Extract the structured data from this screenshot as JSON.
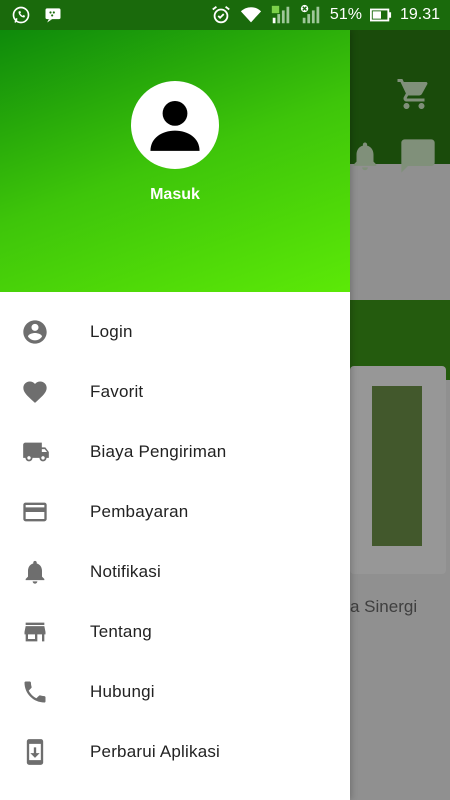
{
  "status_bar": {
    "battery": "51%",
    "time": "19.31",
    "icons": [
      "whatsapp-icon",
      "bbm-icon",
      "alarm-icon",
      "wifi-icon",
      "signal-icon",
      "signal-no-sim-icon",
      "battery-icon"
    ]
  },
  "drawer": {
    "user_label": "Masuk",
    "items": [
      {
        "label": "Login",
        "icon": "account-circle-icon"
      },
      {
        "label": "Favorit",
        "icon": "heart-icon"
      },
      {
        "label": "Biaya Pengiriman",
        "icon": "truck-icon"
      },
      {
        "label": "Pembayaran",
        "icon": "credit-card-icon"
      },
      {
        "label": "Notifikasi",
        "icon": "bell-icon"
      },
      {
        "label": "Tentang",
        "icon": "store-icon"
      },
      {
        "label": "Hubungi",
        "icon": "phone-icon"
      },
      {
        "label": "Perbarui Aplikasi",
        "icon": "app-update-icon"
      }
    ]
  },
  "background": {
    "partial_text": "a Sinergi"
  },
  "colors": {
    "header_gradient_start": "#0e8a0b",
    "header_gradient_end": "#5ce907",
    "icon_gray": "#6e6e6e",
    "status_bar": "#1a6a0c"
  }
}
